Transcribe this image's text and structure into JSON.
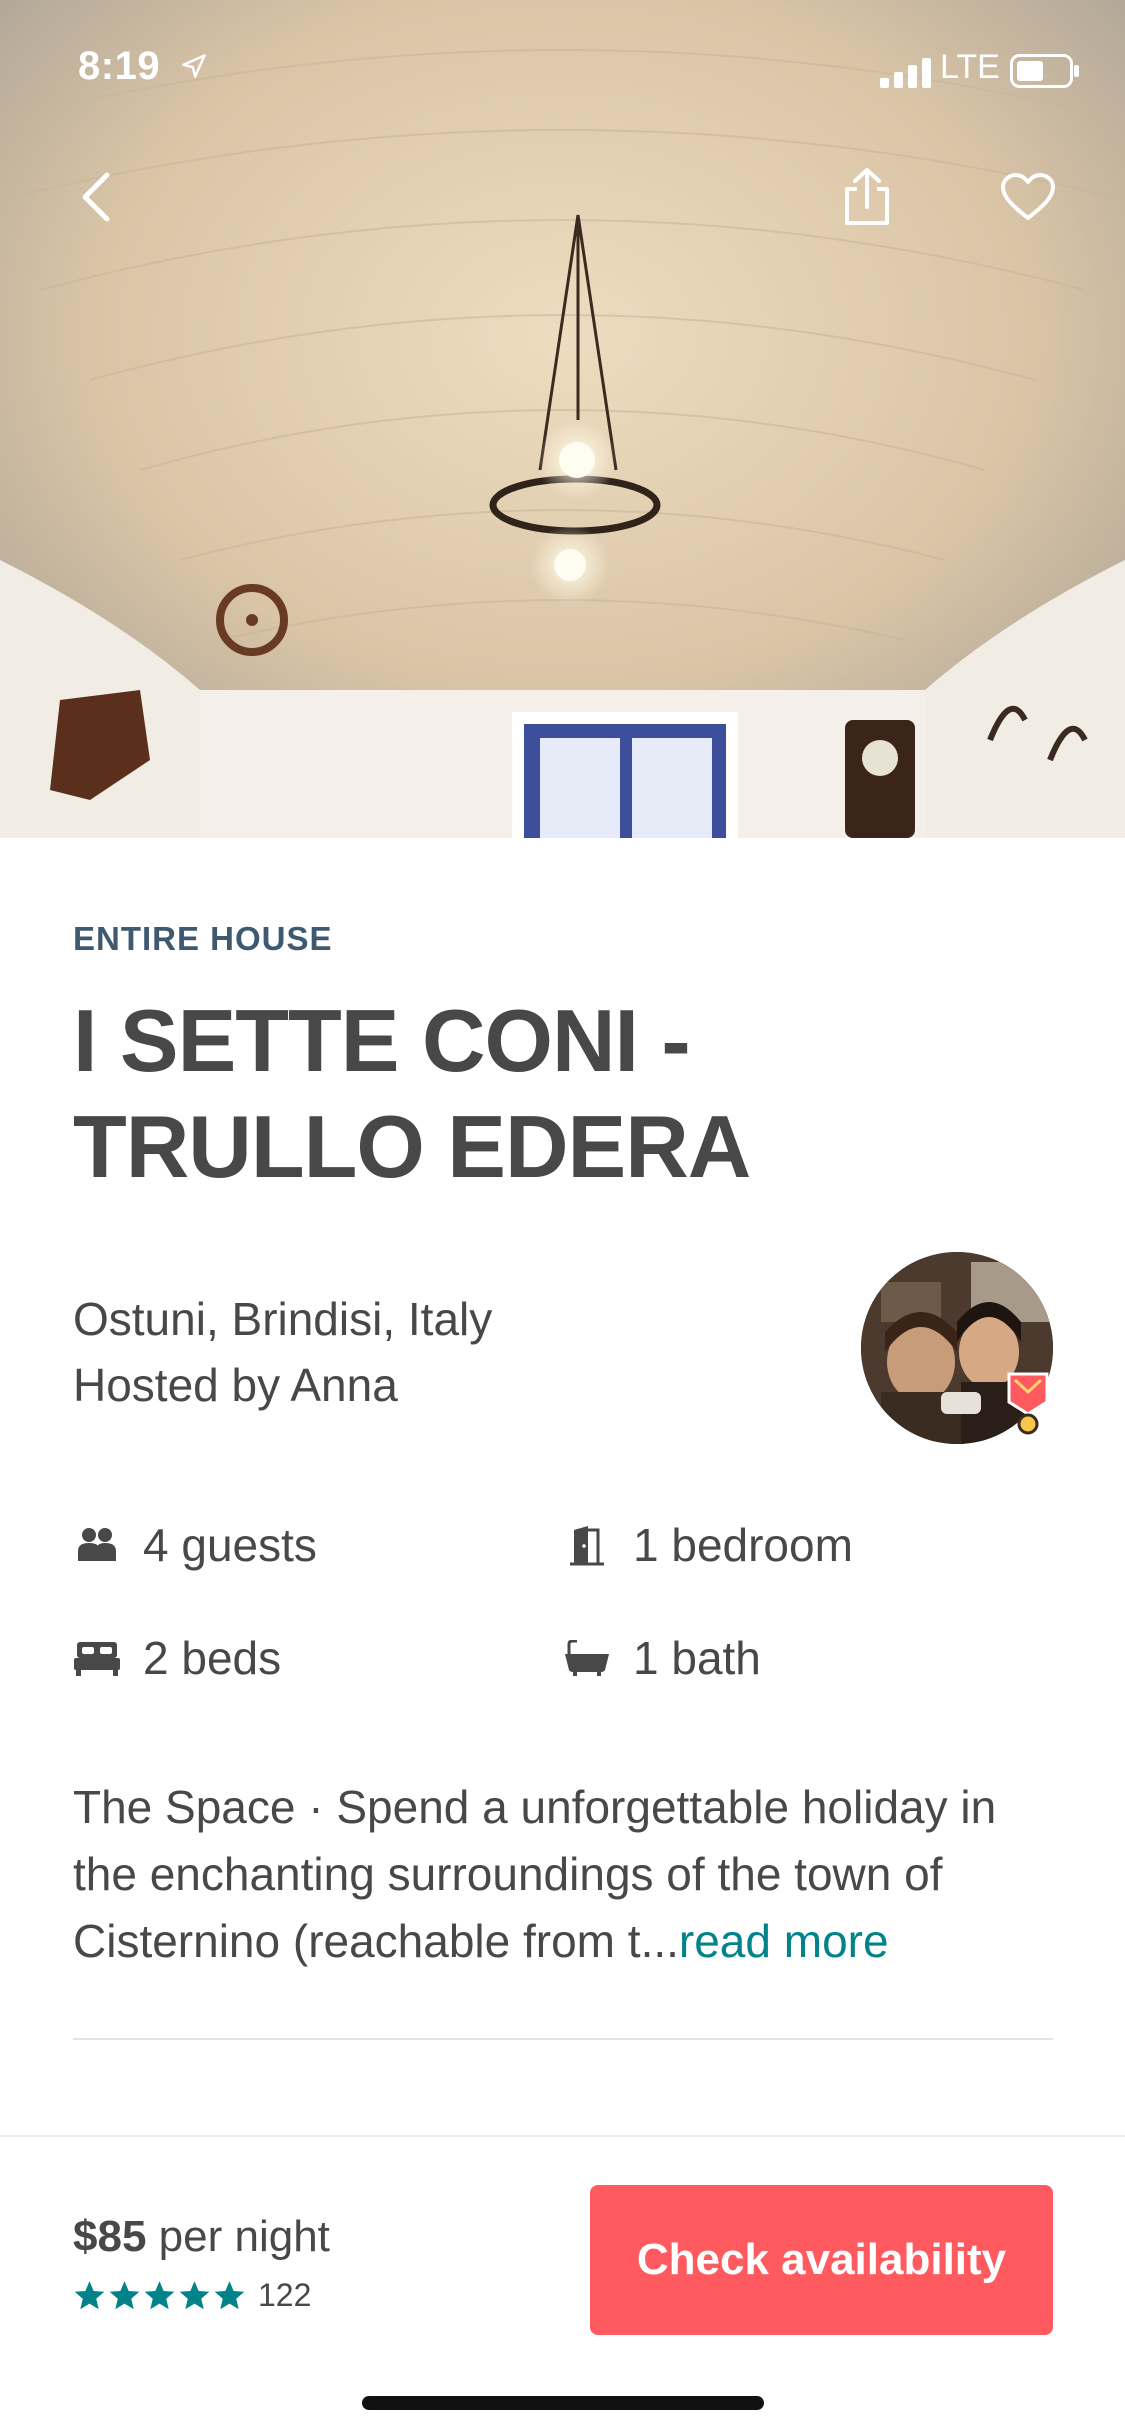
{
  "status_bar": {
    "time": "8:19",
    "carrier": "LTE"
  },
  "nav": {
    "back_icon": "chevron-left-icon",
    "share_icon": "share-icon",
    "save_icon": "heart-icon"
  },
  "listing": {
    "room_type": "ENTIRE HOUSE",
    "title_line1": "I SETTE CONI -",
    "title_line2": "TRULLO EDERA",
    "location": "Ostuni, Brindisi, Italy",
    "host": "Hosted by Anna",
    "amenities": [
      {
        "icon": "guests-icon",
        "label": "4 guests"
      },
      {
        "icon": "bedroom-door-icon",
        "label": "1 bedroom"
      },
      {
        "icon": "bed-icon",
        "label": "2 beds"
      },
      {
        "icon": "bathtub-icon",
        "label": "1 bath"
      }
    ],
    "description": "The Space · Spend a unforgettable holiday in the enchanting surroundings of the town of Cisternino (reachable from t...",
    "read_more": "read more"
  },
  "booking": {
    "price": "$85",
    "price_unit": "per night",
    "rating_stars": 5,
    "review_count": "122",
    "cta_label": "Check availability"
  },
  "colors": {
    "accent": "#ff5a5f",
    "link": "#008489",
    "room_type": "#3f5a70",
    "text": "#484848"
  }
}
